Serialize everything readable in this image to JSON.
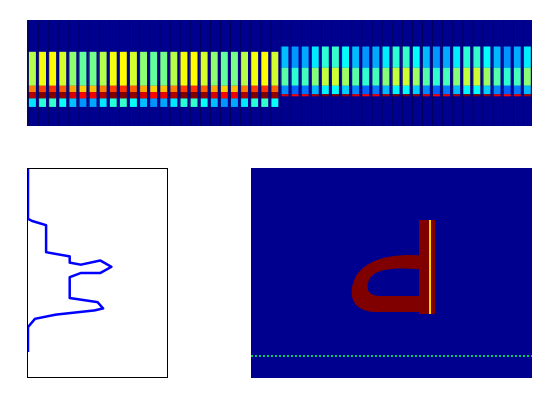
{
  "colors": {
    "background": "#ffffff",
    "jet_low": "#00008f",
    "profile_line": "#0000ff",
    "blob": "#800000",
    "dotted_line": "#00cc66",
    "separator": "#000000"
  },
  "chart_data": [
    {
      "type": "heatmap",
      "description_key": "strip-heatmap",
      "colormap": "jet",
      "columns": 50,
      "bands_left": [
        {
          "from": 0.3,
          "to": 0.62,
          "value": 0.55
        },
        {
          "from": 0.62,
          "to": 0.68,
          "value": 0.75
        },
        {
          "from": 0.68,
          "to": 0.74,
          "value": 0.95
        },
        {
          "from": 0.74,
          "to": 0.82,
          "value": 0.35
        }
      ],
      "bands_right": [
        {
          "from": 0.25,
          "to": 0.45,
          "value": 0.35
        },
        {
          "from": 0.45,
          "to": 0.62,
          "value": 0.5
        },
        {
          "from": 0.62,
          "to": 0.7,
          "value": 0.3
        },
        {
          "from": 0.7,
          "to": 0.72,
          "value": 0.95
        }
      ]
    },
    {
      "type": "line",
      "description_key": "intensity-profile",
      "x": [
        0.0,
        0.0,
        0.0,
        0.03,
        0.13,
        0.13,
        0.3,
        0.3,
        0.38,
        0.52,
        0.6,
        0.52,
        0.38,
        0.3,
        0.3,
        0.5,
        0.54,
        0.48,
        0.2,
        0.05,
        0.0,
        0.0
      ],
      "y": [
        0.0,
        0.16,
        0.24,
        0.25,
        0.27,
        0.4,
        0.42,
        0.45,
        0.46,
        0.44,
        0.47,
        0.5,
        0.5,
        0.52,
        0.62,
        0.64,
        0.67,
        0.68,
        0.7,
        0.72,
        0.76,
        0.88
      ]
    },
    {
      "type": "heatmap",
      "description_key": "segmented-image",
      "shape_label": "d",
      "dotted_line_level": 0.9
    }
  ]
}
